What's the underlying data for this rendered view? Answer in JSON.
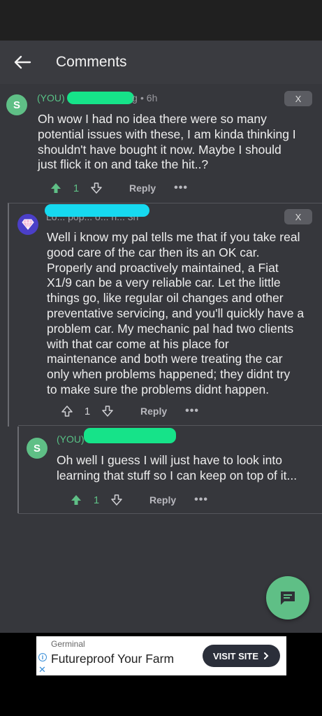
{
  "header": {
    "title": "Comments"
  },
  "colors": {
    "accent_green": "#5fbf86",
    "background": "#36373c",
    "header": "#3a3b40",
    "redaction_green": "#16e389",
    "redaction_cyan": "#16d9f0"
  },
  "comments": [
    {
      "avatar_letter": "S",
      "author_label": "(YOU)",
      "author_tail": "g",
      "time": "• 6h",
      "hide_label": "X",
      "body": "Oh wow I had no idea there were so many\npotential issues with these, I am kinda thinking I\nshouldn't have bought it now. Maybe I should\njust flick it on and take the hit..?",
      "score": "1",
      "upvoted": true,
      "reply_label": "Reply",
      "more_label": "•••"
    },
    {
      "avatar_icon": "diamond-icon",
      "author_partial": "Lo... pop... o... h... 3h",
      "hide_label": "X",
      "body": "Well i know my pal tells me that if you take real\ngood care of the car then its an OK car.\nProperly and proactively maintained, a Fiat\nX1/9 can be a very reliable car. Let the little\nthings go, like regular oil changes and other\npreventative servicing, and you'll quickly have a\nproblem car.  My mechanic pal had two clients\nwith that car come at his place for\nmaintenance and both were treating the car\nonly when problems happened; they didnt try\nto make sure the problems didnt happen.",
      "score": "1",
      "upvoted": false,
      "reply_label": "Reply",
      "more_label": "•••"
    },
    {
      "avatar_letter": "S",
      "author_label": "(YOU)",
      "author_tail": "...",
      "hide_label": "",
      "body": "Oh well I guess I will just have to look into\nlearning that stuff so I can keep on top of it...",
      "score": "1",
      "upvoted": true,
      "reply_label": "Reply",
      "more_label": "•••"
    }
  ],
  "ad": {
    "brand": "Germinal",
    "headline": "Futureproof Your Farm",
    "cta": "VISIT SITE",
    "info_icon": "info-icon",
    "close_icon": "close-icon"
  }
}
